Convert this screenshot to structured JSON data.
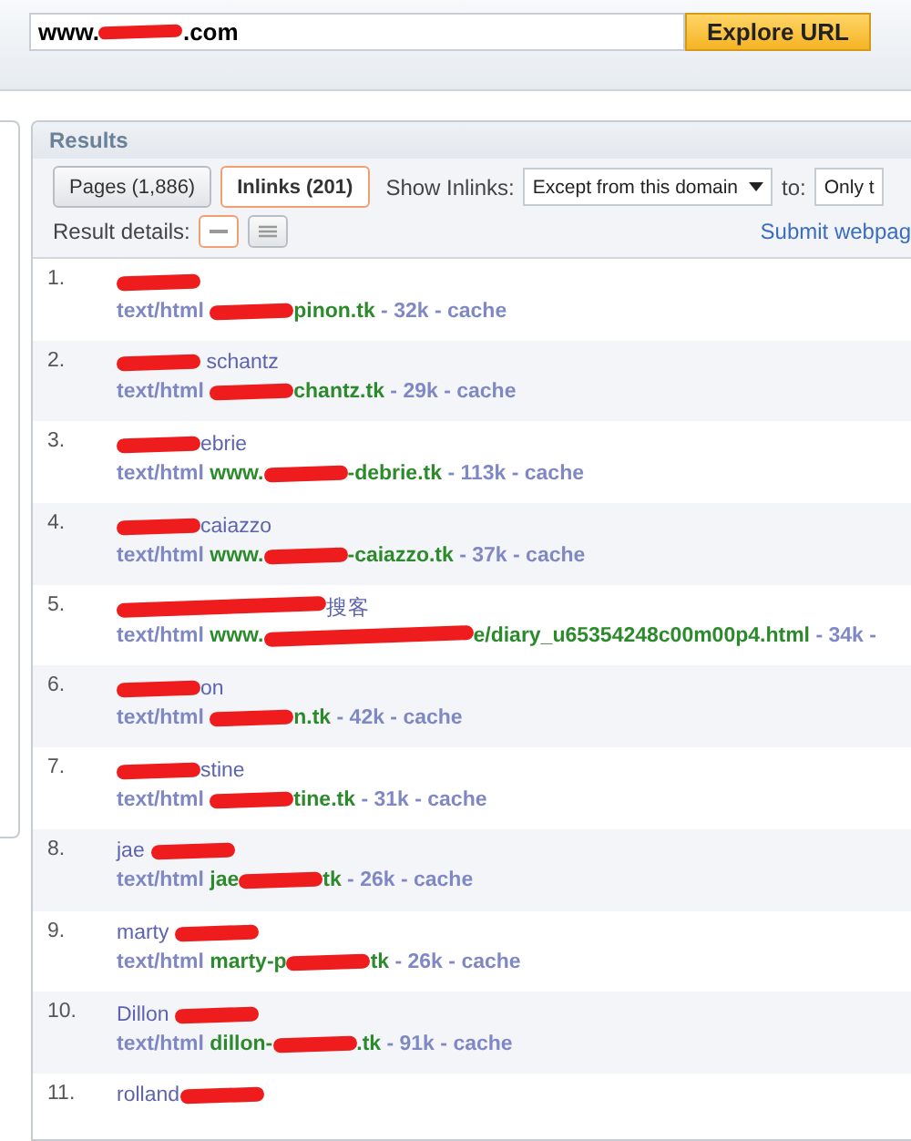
{
  "explore": {
    "url": [
      {
        "kind": "text",
        "text": "www."
      },
      {
        "kind": "redacted"
      },
      {
        "kind": "text",
        "text": ".com"
      }
    ],
    "button": "Explore URL"
  },
  "results": {
    "title": "Results",
    "tabs": [
      {
        "label": "Pages (1,886)",
        "selected": false
      },
      {
        "label": "Inlinks (201)",
        "selected": true
      }
    ],
    "show_label": "Show Inlinks:",
    "show_select": "Except from this domain",
    "to_label": "to:",
    "to_select": "Only t",
    "details_label": "Result details:",
    "views": [
      {
        "kind": "compact",
        "selected": true
      },
      {
        "kind": "detailed",
        "selected": false
      }
    ],
    "submit_link": "Submit webpag",
    "items": [
      {
        "number": "1.",
        "title": [
          {
            "kind": "redacted"
          }
        ],
        "mime": "text/html",
        "url": [
          {
            "kind": "redacted"
          },
          {
            "kind": "text",
            "text": "pinon.tk"
          }
        ],
        "size": "- 32k -",
        "cache": "cache"
      },
      {
        "number": "2.",
        "title": [
          {
            "kind": "redacted"
          },
          {
            "kind": "text",
            "text": " schantz"
          }
        ],
        "mime": "text/html",
        "url": [
          {
            "kind": "redacted"
          },
          {
            "kind": "text",
            "text": "chantz.tk"
          }
        ],
        "size": "- 29k -",
        "cache": "cache"
      },
      {
        "number": "3.",
        "title": [
          {
            "kind": "redacted"
          },
          {
            "kind": "text",
            "text": "ebrie"
          }
        ],
        "mime": "text/html",
        "url": [
          {
            "kind": "text",
            "text": "www."
          },
          {
            "kind": "redacted"
          },
          {
            "kind": "text",
            "text": "-debrie.tk"
          }
        ],
        "size": "- 113k -",
        "cache": "cache"
      },
      {
        "number": "4.",
        "title": [
          {
            "kind": "redacted"
          },
          {
            "kind": "text",
            "text": "caiazzo"
          }
        ],
        "mime": "text/html",
        "url": [
          {
            "kind": "text",
            "text": "www."
          },
          {
            "kind": "redacted"
          },
          {
            "kind": "text",
            "text": "-caiazzo.tk"
          }
        ],
        "size": "- 37k -",
        "cache": "cache"
      },
      {
        "number": "5.",
        "title": [
          {
            "kind": "redacted_long"
          },
          {
            "kind": "text",
            "text": "搜客"
          }
        ],
        "mime": "text/html",
        "url": [
          {
            "kind": "text",
            "text": "www."
          },
          {
            "kind": "redacted_long"
          },
          {
            "kind": "text",
            "text": "e/diary_u65354248c00m00p4.html"
          }
        ],
        "size": "- 34k -"
      },
      {
        "number": "6.",
        "title": [
          {
            "kind": "redacted"
          },
          {
            "kind": "text",
            "text": "on"
          }
        ],
        "mime": "text/html",
        "url": [
          {
            "kind": "redacted"
          },
          {
            "kind": "text",
            "text": "n.tk"
          }
        ],
        "size": "- 42k -",
        "cache": "cache"
      },
      {
        "number": "7.",
        "title": [
          {
            "kind": "redacted"
          },
          {
            "kind": "text",
            "text": "stine"
          }
        ],
        "mime": "text/html",
        "url": [
          {
            "kind": "redacted"
          },
          {
            "kind": "text",
            "text": "tine.tk"
          }
        ],
        "size": "- 31k -",
        "cache": "cache"
      },
      {
        "number": "8.",
        "title": [
          {
            "kind": "text",
            "text": "jae "
          },
          {
            "kind": "redacted"
          }
        ],
        "mime": "text/html",
        "url": [
          {
            "kind": "text",
            "text": "jae"
          },
          {
            "kind": "redacted"
          },
          {
            "kind": "text",
            "text": "tk"
          }
        ],
        "size": "- 26k -",
        "cache": "cache"
      },
      {
        "number": "9.",
        "title": [
          {
            "kind": "text",
            "text": "marty "
          },
          {
            "kind": "redacted"
          }
        ],
        "mime": "text/html",
        "url": [
          {
            "kind": "text",
            "text": "marty-p"
          },
          {
            "kind": "redacted"
          },
          {
            "kind": "text",
            "text": "tk"
          }
        ],
        "size": "- 26k -",
        "cache": "cache"
      },
      {
        "number": "10.",
        "title": [
          {
            "kind": "text",
            "text": "Dillon "
          },
          {
            "kind": "redacted"
          }
        ],
        "mime": "text/html",
        "url": [
          {
            "kind": "text",
            "text": "dillon-"
          },
          {
            "kind": "redacted"
          },
          {
            "kind": "text",
            "text": ".tk"
          }
        ],
        "size": "- 91k -",
        "cache": "cache"
      },
      {
        "number": "11.",
        "title": [
          {
            "kind": "text",
            "text": "rolland"
          },
          {
            "kind": "redacted"
          }
        ]
      }
    ]
  }
}
